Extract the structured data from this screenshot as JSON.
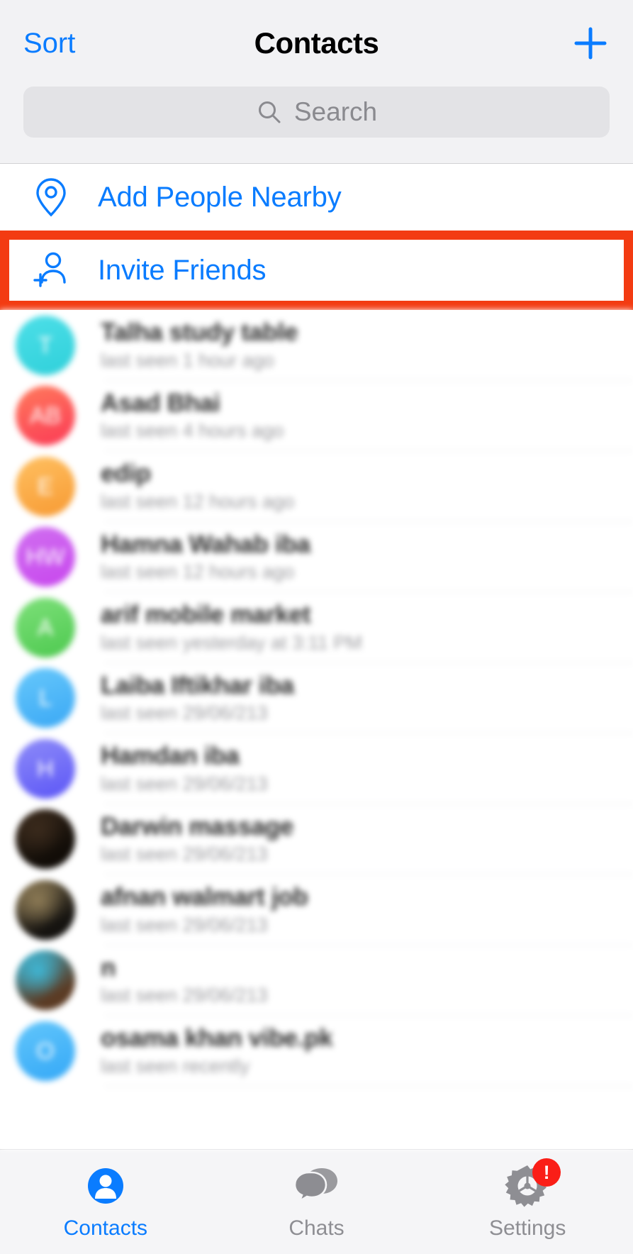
{
  "navbar": {
    "sort_label": "Sort",
    "title": "Contacts",
    "add_icon": "plus-icon"
  },
  "search": {
    "placeholder": "Search",
    "value": "",
    "icon": "search-icon"
  },
  "actions": [
    {
      "label": "Add People Nearby",
      "icon": "location-pin-icon"
    },
    {
      "label": "Invite Friends",
      "icon": "person-add-icon",
      "highlighted": true
    }
  ],
  "highlight": {
    "color": "#f33b12",
    "target": "Invite Friends"
  },
  "colors": {
    "accent": "#0a7cff",
    "highlight": "#f33b12",
    "badge": "#fa1e17",
    "nav_bg": "#f2f2f4",
    "search_bg": "#e3e3e6"
  },
  "contacts": [
    {
      "name": "Talha study table",
      "status": "last seen 1 hour ago",
      "initials": "T",
      "avatar_type": "color",
      "color_from": "#4ddfe8",
      "color_to": "#2fd0da"
    },
    {
      "name": "Asad Bhai",
      "status": "last seen 4 hours ago",
      "initials": "AB",
      "avatar_type": "color",
      "color_from": "#ff7a5c",
      "color_to": "#fb3a56"
    },
    {
      "name": "edip",
      "status": "last seen 12 hours ago",
      "initials": "E",
      "avatar_type": "color",
      "color_from": "#ffc061",
      "color_to": "#f79a33"
    },
    {
      "name": "Hamna Wahab iba",
      "status": "last seen 12 hours ago",
      "initials": "HW",
      "avatar_type": "color",
      "color_from": "#d06ff0",
      "color_to": "#c846ee"
    },
    {
      "name": "arif mobile market",
      "status": "last seen yesterday at 3:11 PM",
      "initials": "A",
      "avatar_type": "color",
      "color_from": "#7ee07a",
      "color_to": "#4dc94f"
    },
    {
      "name": "Laiba Iftikhar iba",
      "status": "last seen 29/06/213",
      "initials": "L",
      "avatar_type": "color",
      "color_from": "#67c8fb",
      "color_to": "#3aa8f5"
    },
    {
      "name": "Hamdan iba",
      "status": "last seen 29/06/213",
      "initials": "H",
      "avatar_type": "color",
      "color_from": "#8e8cf8",
      "color_to": "#5b55f7"
    },
    {
      "name": "Darwin massage",
      "status": "last seen 29/06/213",
      "initials": "",
      "avatar_type": "photo",
      "color_from": "#3a2a1c",
      "color_to": "#120d08"
    },
    {
      "name": "afnan walmart job",
      "status": "last seen 29/06/213",
      "initials": "",
      "avatar_type": "photo",
      "color_from": "#8c7a55",
      "color_to": "#151310"
    },
    {
      "name": "n",
      "status": "last seen 29/06/213",
      "initials": "",
      "avatar_type": "photo",
      "color_from": "#3fb6d4",
      "color_to": "#5b3b24"
    },
    {
      "name": "osama khan vibe.pk",
      "status": "last seen recently",
      "initials": "O",
      "avatar_type": "color",
      "color_from": "#62c6fb",
      "color_to": "#34a8f7"
    }
  ],
  "tabbar": [
    {
      "label": "Contacts",
      "icon": "person-filled-icon",
      "active": true,
      "badge": ""
    },
    {
      "label": "Chats",
      "icon": "chat-bubbles-icon",
      "active": false,
      "badge": ""
    },
    {
      "label": "Settings",
      "icon": "gear-icon",
      "active": false,
      "badge": "!"
    }
  ]
}
